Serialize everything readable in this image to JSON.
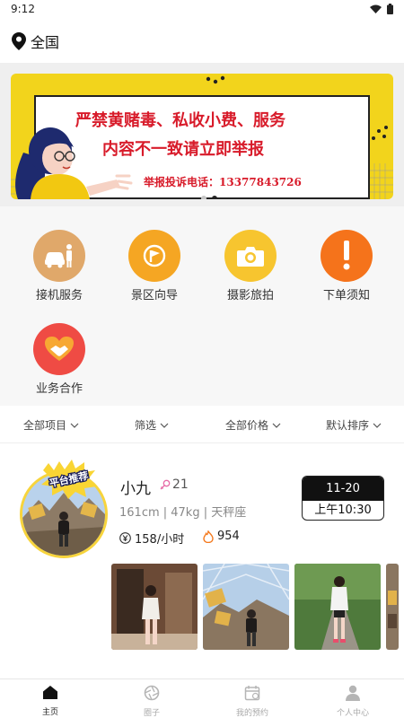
{
  "status_bar": {
    "time": "9:12"
  },
  "location": {
    "label": "全国"
  },
  "banner": {
    "line1": "严禁黄赌毒、私收小费、服务",
    "line2": "内容不一致请立即举报",
    "line3": "举报投诉电话：13377843726",
    "active_dot": 2,
    "dot_count": 2
  },
  "services": [
    {
      "label": "接机服务",
      "icon": "car-person-icon",
      "color": "#e0a86a"
    },
    {
      "label": "景区向导",
      "icon": "flag-icon",
      "color": "#f5a623"
    },
    {
      "label": "摄影旅拍",
      "icon": "camera-icon",
      "color": "#f7c52f"
    },
    {
      "label": "下单须知",
      "icon": "exclamation-icon",
      "color": "#f5731b"
    },
    {
      "label": "业务合作",
      "icon": "handshake-heart-icon",
      "color": "#ef4b44"
    }
  ],
  "filters": [
    {
      "label": "全部项目"
    },
    {
      "label": "筛选"
    },
    {
      "label": "全部价格"
    },
    {
      "label": "默认排序"
    }
  ],
  "listing": {
    "badge": "平台推荐",
    "name": "小九",
    "age": "21",
    "stats": "161cm | 47kg | 天秤座",
    "price": "158/小时",
    "heat": "954",
    "date": "11-20",
    "time": "上午10:30"
  },
  "tabs": [
    {
      "label": "主页",
      "icon": "home-icon",
      "active": true
    },
    {
      "label": "圈子",
      "icon": "aperture-icon",
      "active": false
    },
    {
      "label": "我的预约",
      "icon": "calendar-icon",
      "active": false
    },
    {
      "label": "个人中心",
      "icon": "user-icon",
      "active": false
    }
  ],
  "colors": {
    "accent": "#f2d41c",
    "danger": "#d81b2a",
    "text": "#333333"
  }
}
